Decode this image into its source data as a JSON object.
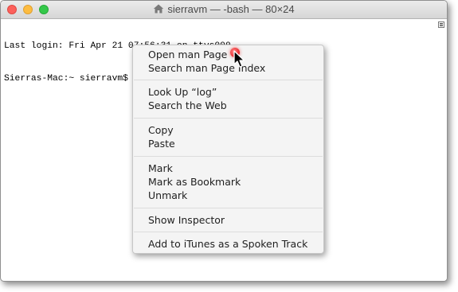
{
  "window": {
    "title": "sierravm — -bash — 80×24"
  },
  "terminal": {
    "lines": [
      "Last login: Fri Apr 21 07:56:31 on ttys000",
      "Sierras-Mac:~ sierravm$ log "
    ]
  },
  "context_menu": {
    "items": [
      "Open man Page",
      "Search man Page Index",
      "Look Up “log”",
      "Search the Web",
      "Copy",
      "Paste",
      "Mark",
      "Mark as Bookmark",
      "Unmark",
      "Show Inspector",
      "Add to iTunes as a Spoken Track"
    ]
  },
  "colors": {
    "close": "#fc605b",
    "minimize": "#fdbc40",
    "zoom": "#34c84a",
    "menu_background": "#f4f4f4",
    "click_indicator": "#e8262a"
  },
  "icons": {
    "title": "home-icon",
    "scrollbar": "scroll-marker-icon",
    "pointer": "mouse-pointer-icon"
  }
}
